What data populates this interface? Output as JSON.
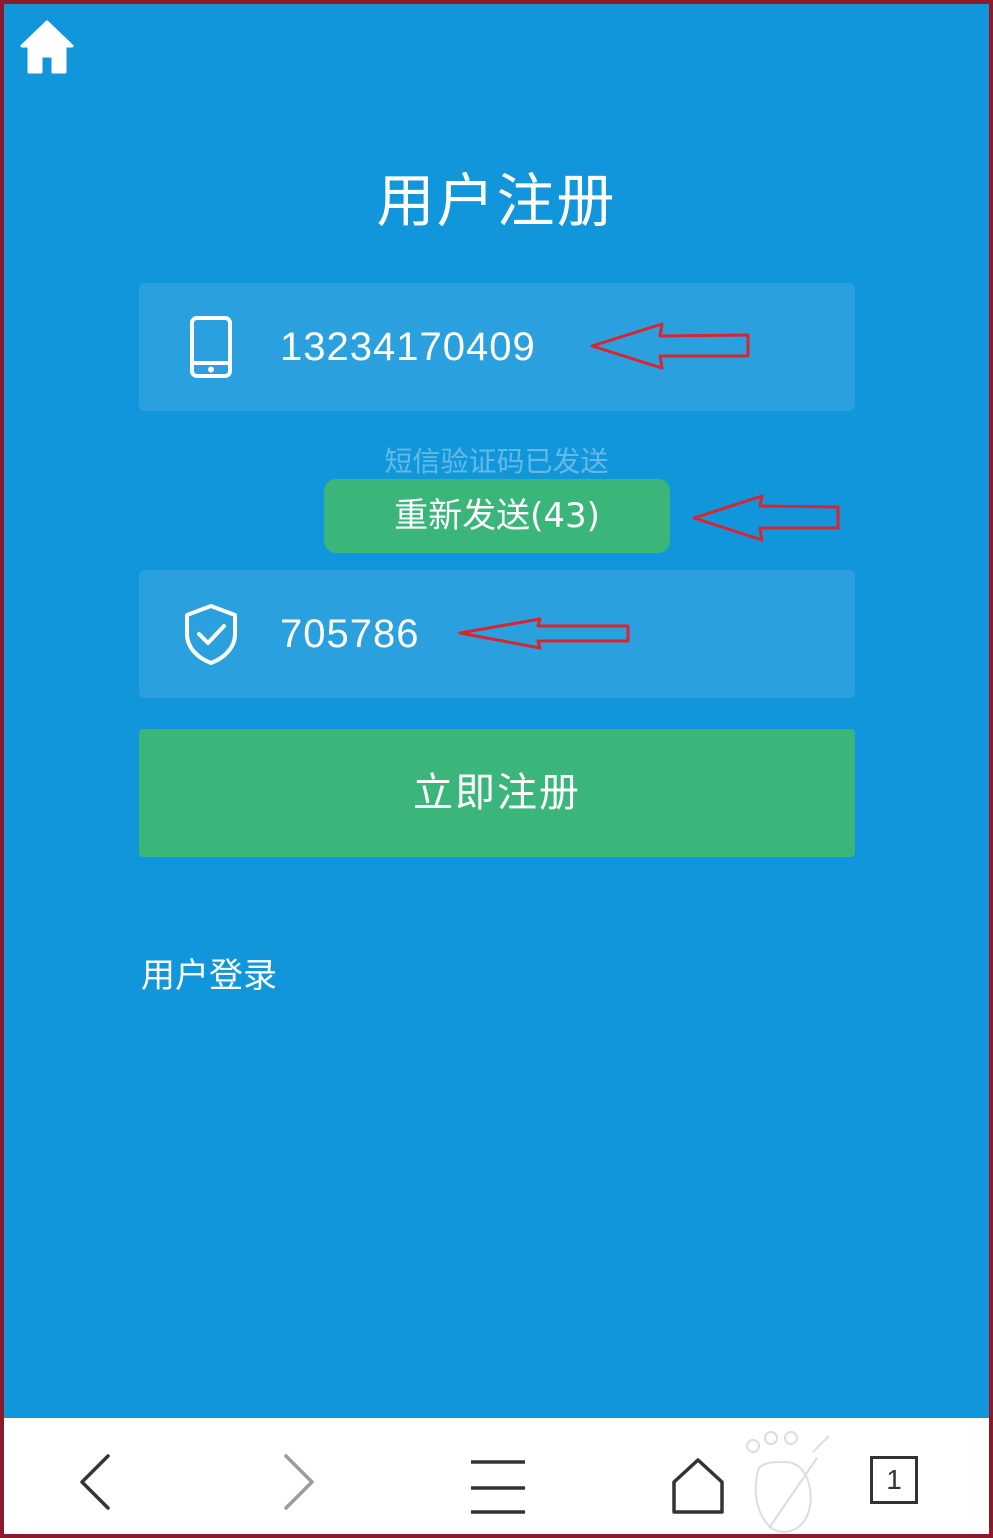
{
  "page": {
    "title": "用户注册"
  },
  "phone_field": {
    "value": "13234170409"
  },
  "sms": {
    "hint": "短信验证码已发送",
    "resend_label": "重新发送(43)"
  },
  "code_field": {
    "value": "705786"
  },
  "register_button": {
    "label": "立即注册"
  },
  "login_link": {
    "label": "用户登录"
  },
  "browser_bar": {
    "tab_count": "1"
  },
  "icons": {
    "home": "home-icon",
    "phone": "phone-icon",
    "shield": "shield-check-icon",
    "back": "chevron-left-icon",
    "forward": "chevron-right-icon",
    "menu": "menu-icon",
    "browser_home": "house-outline-icon"
  },
  "colors": {
    "background": "#1296db",
    "accent_green": "#3bb67a",
    "annotation_red": "#d9252f"
  }
}
